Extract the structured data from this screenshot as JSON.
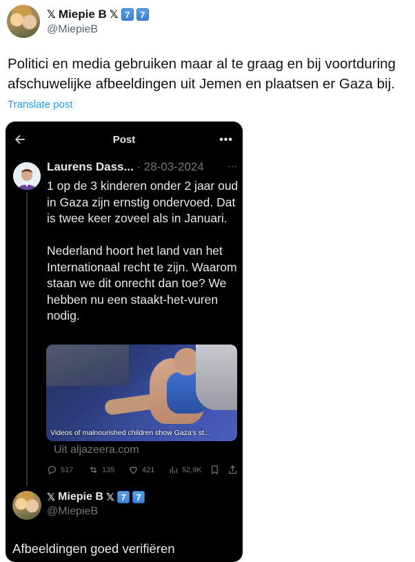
{
  "outer_post": {
    "display_name": "Miepie B",
    "name_prefix_glyph": "𝕏",
    "name_suffix_glyph": "𝕏",
    "keycaps": [
      "7",
      "7"
    ],
    "handle": "@MiepieB",
    "text": "Politici en media gebruiken maar al te graag en bij voortduring afschuwelijke afbeeldingen uit Jemen en plaatsen er Gaza bij.",
    "translate_label": "Translate post"
  },
  "embedded_screenshot": {
    "header_title": "Post",
    "more_glyph": "•••",
    "quoted_post": {
      "author": "Laurens Dass...",
      "date": "· 28-03-2024",
      "more_glyph": "···",
      "text": "1 op de 3 kinderen onder 2 jaar oud in Gaza zijn ernstig ondervoed. Dat is twee keer zoveel als in Januari.\n\nNederland hoort het land van het Internationaal recht te zijn. Waarom staan we dit onrecht dan toe? We hebben nu een staakt-het-vuren nodig.",
      "media_caption": "Videos of malnourished children show Gaza's st...",
      "link_source": "Uit aljazeera.com",
      "stats": {
        "replies": "517",
        "reposts": "135",
        "likes": "421",
        "views": "52,9K"
      }
    },
    "reply": {
      "display_name": "Miepie B",
      "name_prefix_glyph": "𝕏",
      "name_suffix_glyph": "𝕏",
      "keycaps": [
        "7",
        "7"
      ],
      "handle": "@MiepieB",
      "text": "Afbeeldingen goed verifiëren"
    }
  },
  "colors": {
    "link_blue": "#1d9bf0",
    "muted_gray": "#536471",
    "dark_bg": "#000000",
    "dark_text": "#e7e9ea",
    "dark_muted": "#71767b"
  }
}
